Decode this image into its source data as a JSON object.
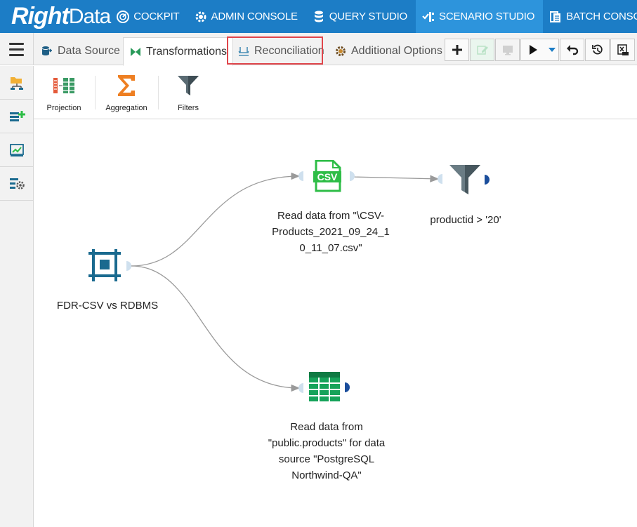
{
  "app": {
    "logo_part1": "Right",
    "logo_part2": "Data"
  },
  "topnav": {
    "items": [
      {
        "label": "COCKPIT",
        "icon": "gauge-icon"
      },
      {
        "label": "ADMIN CONSOLE",
        "icon": "gear-icon"
      },
      {
        "label": "QUERY STUDIO",
        "icon": "database-icon"
      },
      {
        "label": "SCENARIO STUDIO",
        "icon": "scenario-icon",
        "active": true
      },
      {
        "label": "BATCH CONSOLE",
        "icon": "batch-icon"
      }
    ]
  },
  "tabs": [
    {
      "label": "Data Source",
      "icon": "datasource-icon"
    },
    {
      "label": "Transformations",
      "icon": "transform-icon",
      "active": true
    },
    {
      "label": "Reconciliation",
      "icon": "reconciliation-icon",
      "highlighted": true
    },
    {
      "label": "Additional Options",
      "icon": "gear-icon"
    }
  ],
  "toolbar": {
    "buttons": [
      "add-icon",
      "edit-icon",
      "monitor-icon",
      "play-icon",
      "dropdown-icon",
      "undo-icon",
      "history-icon",
      "excel-icon"
    ]
  },
  "sidebar": {
    "buttons": [
      "folder-tree-icon",
      "add-table-icon",
      "chart-icon",
      "settings-tree-icon"
    ]
  },
  "palette": {
    "items": [
      {
        "label": "Projection",
        "icon": "projection-icon"
      },
      {
        "label": "Aggregation",
        "icon": "sigma-icon"
      },
      {
        "label": "Filters",
        "icon": "funnel-icon"
      }
    ]
  },
  "diagram": {
    "nodes": {
      "scenario": {
        "label": "FDR-CSV vs RDBMS",
        "icon": "scenario-node-icon"
      },
      "csv": {
        "label_lines": [
          "Read data from \"\\CSV-",
          "Products_2021_09_24_1",
          "0_11_07.csv\""
        ],
        "icon": "csv-file-icon",
        "icon_text": "CSV"
      },
      "filter": {
        "label": "productid > '20'",
        "icon": "funnel-icon"
      },
      "db": {
        "label_lines": [
          "Read data from",
          "\"public.products\" for data",
          "source \"PostgreSQL",
          "Northwind-QA\""
        ],
        "icon": "table-icon"
      }
    }
  },
  "colors": {
    "nav_bg": "#1c7dc6",
    "nav_active": "#2d94dc",
    "highlight": "#e0454b",
    "csv_green": "#2ebd47",
    "table_green": "#16a35a",
    "node_blue": "#1a6a8f"
  }
}
